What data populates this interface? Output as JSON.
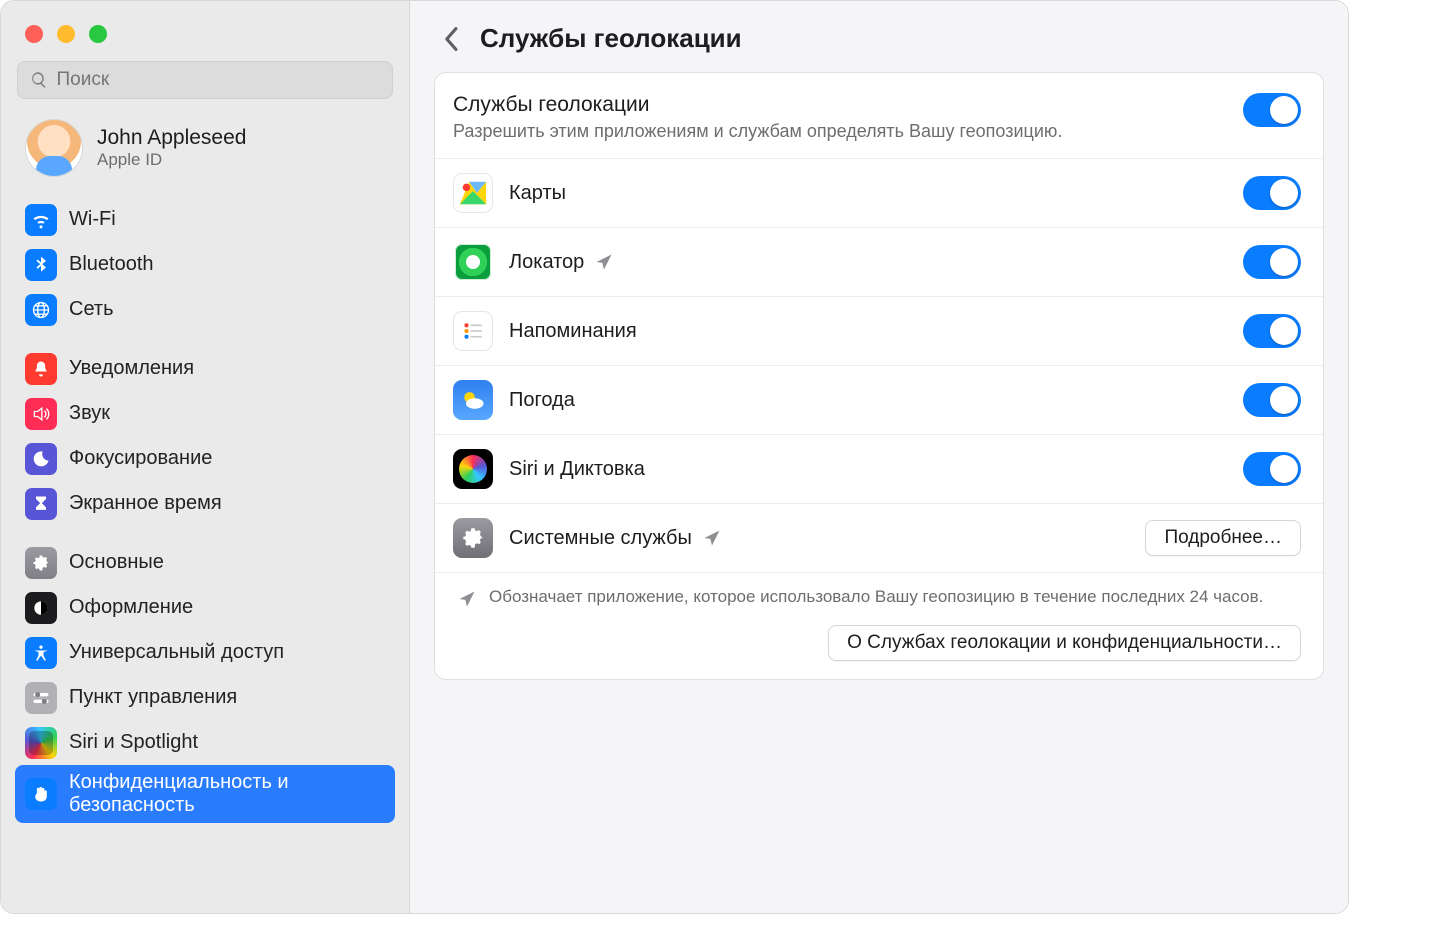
{
  "search": {
    "placeholder": "Поиск"
  },
  "account": {
    "name": "John Appleseed",
    "sub": "Apple ID"
  },
  "sidebar": {
    "group1": [
      {
        "label": "Wi-Fi"
      },
      {
        "label": "Bluetooth"
      },
      {
        "label": "Сеть"
      }
    ],
    "group2": [
      {
        "label": "Уведомления"
      },
      {
        "label": "Звук"
      },
      {
        "label": "Фокусирование"
      },
      {
        "label": "Экранное время"
      }
    ],
    "group3": [
      {
        "label": "Основные"
      },
      {
        "label": "Оформление"
      },
      {
        "label": "Универсальный доступ"
      },
      {
        "label": "Пункт управления"
      },
      {
        "label": "Siri и Spotlight"
      },
      {
        "label_line1": "Конфиденциальность и",
        "label_line2": "безопасность"
      }
    ]
  },
  "page": {
    "title": "Службы геолокации",
    "header_title": "Службы геолокации",
    "header_sub": "Разрешить этим приложениям и службам определять Вашу геопозицию.",
    "apps": [
      {
        "label": "Карты",
        "arrow": false,
        "toggle": true
      },
      {
        "label": "Локатор",
        "arrow": true,
        "toggle": true
      },
      {
        "label": "Напоминания",
        "arrow": false,
        "toggle": true
      },
      {
        "label": "Погода",
        "arrow": false,
        "toggle": true
      },
      {
        "label": "Siri и Диктовка",
        "arrow": false,
        "toggle": true
      }
    ],
    "system_services_label": "Системные службы",
    "details_button": "Подробнее…",
    "footnote": "Обозначает приложение, которое использовало Вашу геопозицию в течение последних 24 часов.",
    "about_button": "О Службах геолокации и конфиденциальности…"
  }
}
